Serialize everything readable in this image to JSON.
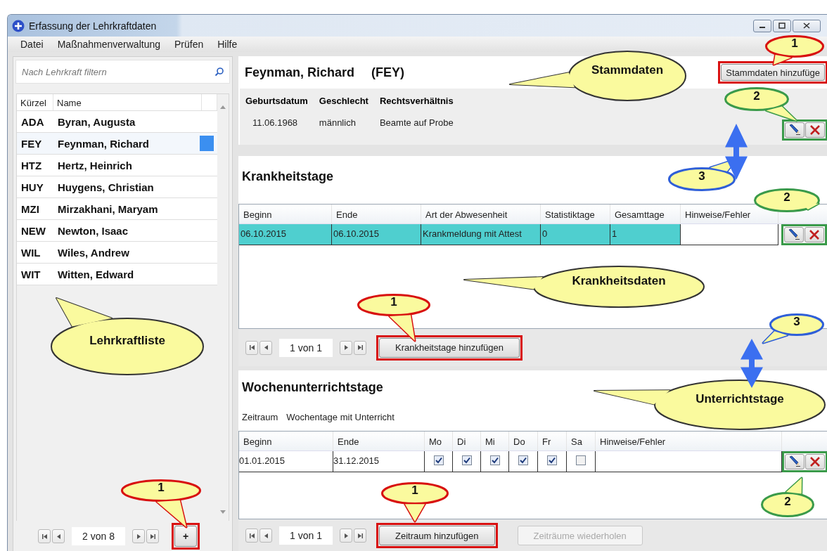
{
  "window": {
    "title": "Erfassung der Lehrkraftdaten"
  },
  "menu": [
    "Datei",
    "Maßnahmenverwaltung",
    "Prüfen",
    "Hilfe"
  ],
  "teacher_panel": {
    "filter": {
      "placeholder": "Nach Lehrkraft filtern"
    },
    "columns": [
      "Kürzel",
      "Name"
    ],
    "rows": [
      {
        "code": "ADA",
        "name": "Byran, Augusta",
        "selected": false
      },
      {
        "code": "FEY",
        "name": "Feynman, Richard",
        "selected": true
      },
      {
        "code": "HTZ",
        "name": "Hertz, Heinrich",
        "selected": false
      },
      {
        "code": "HUY",
        "name": "Huygens, Christian",
        "selected": false
      },
      {
        "code": "MZI",
        "name": "Mirzakhani, Maryam",
        "selected": false
      },
      {
        "code": "NEW",
        "name": "Newton, Isaac",
        "selected": false
      },
      {
        "code": "WIL",
        "name": "Wiles, Andrew",
        "selected": false
      },
      {
        "code": "WIT",
        "name": "Witten, Edward",
        "selected": false
      }
    ],
    "pager": {
      "page": "2 von 8"
    },
    "add_button": {
      "label": "+",
      "color": "#d81010"
    }
  },
  "stammdaten": {
    "name": "Feynman, Richard",
    "code": "(FEY)",
    "add_button": {
      "label": "Stammdaten hinzufüge",
      "color": "#d81010"
    },
    "fields": [
      {
        "label": "Geburtsdatum",
        "value": "11.06.1968"
      },
      {
        "label": "Geschlecht",
        "value": "männlich"
      },
      {
        "label": "Rechtsverhältnis",
        "value": "Beamte auf Probe"
      }
    ],
    "actions": {
      "color": "#3a9a4a"
    }
  },
  "krankheitstage": {
    "title": "Krankheitstage",
    "columns": [
      "Beginn",
      "Ende",
      "Art der Abwesenheit",
      "Statistiktage",
      "Gesamttage",
      "Hinweise/Fehler"
    ],
    "rows": [
      {
        "beginn": "06.10.2015",
        "ende": "06.10.2015",
        "art": "Krankmeldung mit Attest",
        "statistiktage": "0",
        "gesamttage": "1",
        "selected": true
      }
    ],
    "actions": {
      "color": "#3a9a4a"
    },
    "pager": {
      "page": "1 von 1"
    },
    "add_button": {
      "label": "Krankheitstage hinzufügen",
      "color": "#d81010"
    }
  },
  "wochenunterrichtstage": {
    "title": "Wochenunterrichtstage",
    "subheaders": [
      "Zeitraum",
      "Wochentage mit Unterricht"
    ],
    "columns": [
      "Beginn",
      "Ende",
      "Mo",
      "Di",
      "Mi",
      "Do",
      "Fr",
      "Sa",
      "Hinweise/Fehler"
    ],
    "rows": [
      {
        "beginn": "01.01.2015",
        "ende": "31.12.2015",
        "days": [
          {
            "checked": true
          },
          {
            "checked": true
          },
          {
            "checked": true
          },
          {
            "checked": true
          },
          {
            "checked": true
          },
          {
            "checked": false
          }
        ],
        "selected": false
      }
    ],
    "actions": {
      "color": "#3a9a4a"
    },
    "pager": {
      "page": "1 von 1"
    },
    "add_button": {
      "label": "Zeitraum hinzufügen",
      "color": "#d81010"
    },
    "repeat_button": {
      "label": "Zeiträume wiederholen",
      "disabled": true
    }
  },
  "callouts": [
    {
      "text": "1",
      "color": "#d81010"
    },
    {
      "text": "Stammdaten",
      "color": "#333333"
    },
    {
      "text": "2",
      "color": "#3a9a4a"
    },
    {
      "text": "3",
      "color": "#2f5fd8"
    },
    {
      "text": "2",
      "color": "#3a9a4a"
    },
    {
      "text": "Krankheitsdaten",
      "color": "#333333"
    },
    {
      "text": "1",
      "color": "#d81010"
    },
    {
      "text": "3",
      "color": "#2f5fd8"
    },
    {
      "text": "Lehrkraftliste",
      "color": "#333333"
    },
    {
      "text": "Unterrichtstage",
      "color": "#333333"
    },
    {
      "text": "1",
      "color": "#d81010"
    },
    {
      "text": "1",
      "color": "#d81010"
    },
    {
      "text": "2",
      "color": "#3a9a4a"
    }
  ]
}
